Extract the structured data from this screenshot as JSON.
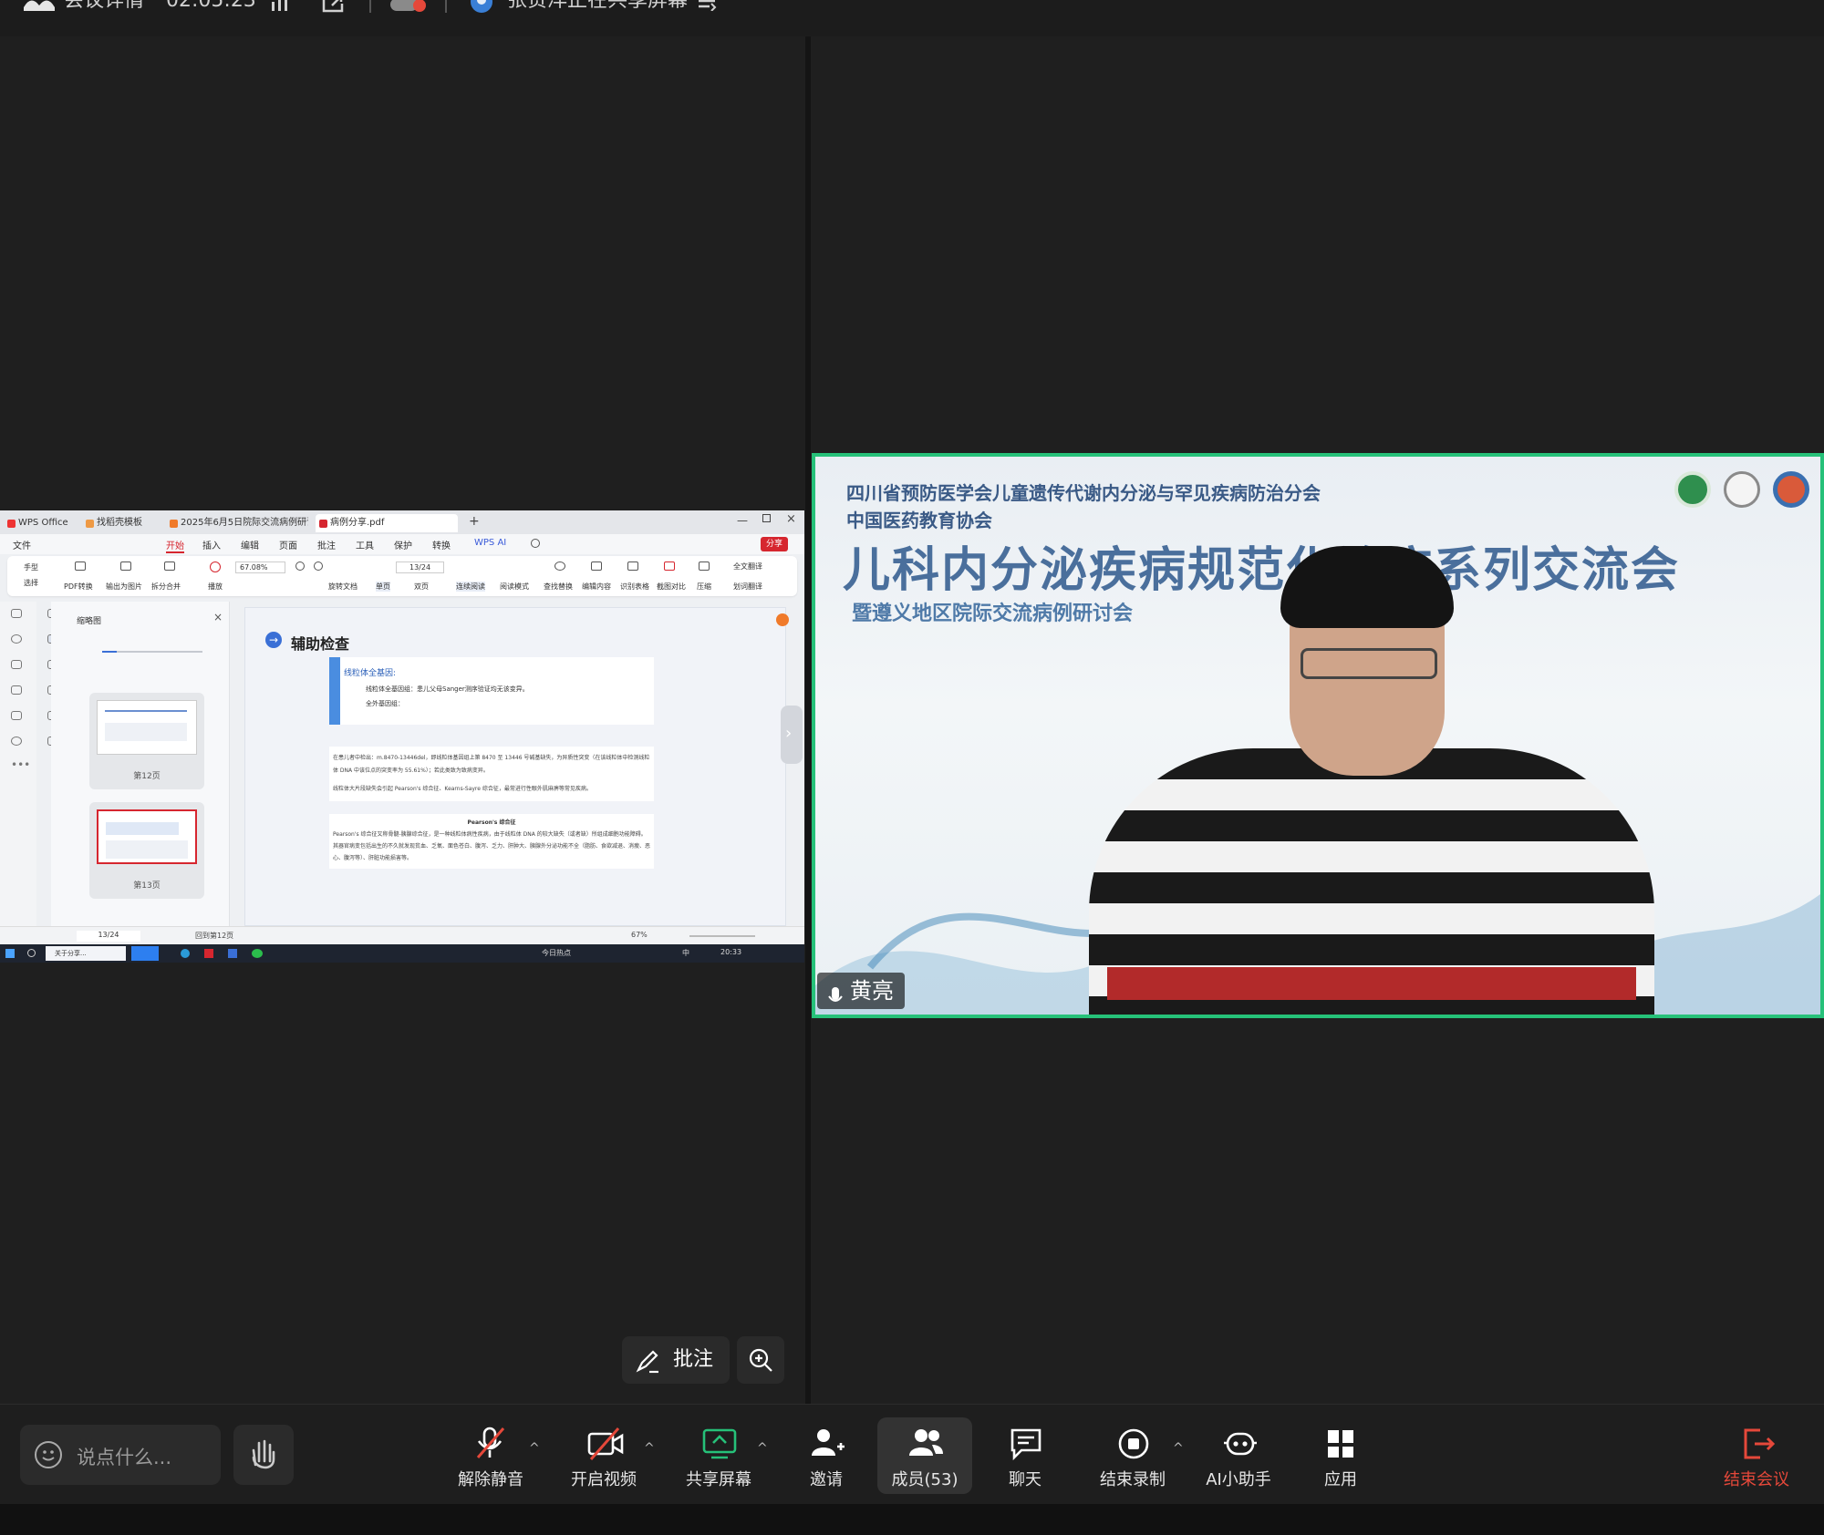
{
  "topbar": {
    "meeting_details": "会议详情",
    "timer": "02:05:23",
    "sharing_status": "张贵洋正在共享屏幕"
  },
  "shared_screen": {
    "tabs": [
      "WPS Office",
      "找稻壳模板",
      "2025年6月5日院际交流病例研讨会",
      "病例分享.pdf"
    ],
    "menu": {
      "file": "文件",
      "items": [
        "开始",
        "插入",
        "编辑",
        "页面",
        "批注",
        "工具",
        "保护",
        "转换"
      ],
      "wps_ai": "WPS AI",
      "share": "分享"
    },
    "ribbon": {
      "hand": "手型",
      "select": "选择",
      "pdf_convert": "PDF转换",
      "export_image": "输出为图片",
      "split_merge": "拆分合并",
      "play": "播放",
      "zoom": "67.08%",
      "page": "13/24",
      "rotate": "旋转文档",
      "single": "单页",
      "double": "双页",
      "continuous": "连续阅读",
      "read_mode": "阅读模式",
      "find_replace": "查找替换",
      "edit_content": "编辑内容",
      "recognize_table": "识别表格",
      "screenshot": "截图对比",
      "compress": "压缩",
      "full_translate": "全文翻译",
      "translate": "划词翻译"
    },
    "thumbnails": {
      "title": "缩略图",
      "pages": [
        {
          "label": "第12页"
        },
        {
          "label": "第13页"
        }
      ]
    },
    "doc": {
      "heading": "辅助检查",
      "box_title": "线粒体全基因:",
      "box_line1": "线粒体全基因组：患儿父母Sanger测序验证均无该变异。",
      "box_line2": "全外基因组：",
      "para1": "在患儿者中检出：m.8470-13446del，即线粒体基因组上第 8470 至 13446 号碱基缺失，为异质性突变（在该线粒体中检测线粒体 DNA 中该位点的突变率为 55.61%）；若此类致为致病变异。",
      "para2": "线粒体大片段缺失会引起 Pearson's 综合征、Kearns-Sayre 综合征，最常进行性眼外肌麻痹等常见疾病。",
      "box3_title": "Pearson's 综合征",
      "box3_text": "Pearson's 综合征又称骨髓-胰腺综合征，是一种线粒体病性疾病，由于线粒体 DNA 的较大缺失（或者缺）所组成细胞功能障碍。其器官病变包括出生的不久就发现贫血、乏氧、面色苍白、腹泻、乏力、肝肿大、胰腺外分泌功能不全（脂肪、食欲减退、消瘦、恶心、腹泻等）、肝脏功能损害等。"
    },
    "status": {
      "page": "13/24",
      "annot": "回到第12页",
      "zoom": "67%"
    },
    "taskbar": {
      "window": "关于分享...",
      "hot": "今日热点",
      "ime": "中",
      "clock": "20:33"
    }
  },
  "video": {
    "org1": "四川省预防医学会儿童遗传代谢内分泌与罕见疾病防治分会",
    "org2": "中国医药教育协会",
    "title": "儿科内分泌疾病规范化诊疗系列交流会",
    "subtitle": "暨遵义地区院际交流病例研讨会",
    "speaker_name": "黄亮"
  },
  "annotate": {
    "annotate_label": "批注"
  },
  "toolbar": {
    "chat_placeholder": "说点什么...",
    "unmute": "解除静音",
    "video": "开启视频",
    "share": "共享屏幕",
    "invite": "邀请",
    "members": "成员(53)",
    "chat": "聊天",
    "record": "结束录制",
    "ai": "AI小助手",
    "apps": "应用",
    "end": "结束会议"
  },
  "colors": {
    "accent_green": "#26c179",
    "end_red": "#e5483a",
    "wps_red": "#d6262f",
    "title_blue": "#3a5a86"
  }
}
